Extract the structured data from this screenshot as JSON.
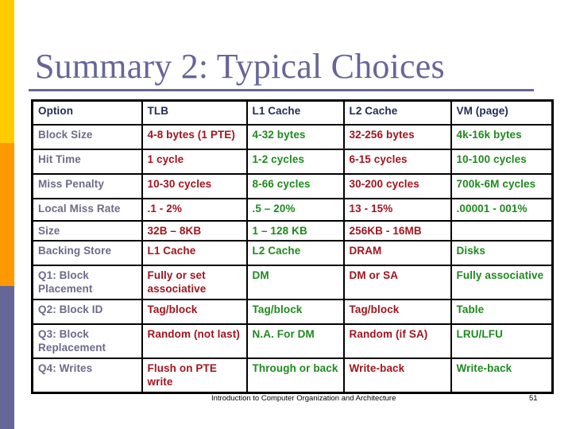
{
  "slide": {
    "title": "Summary 2: Typical Choices",
    "footer": "Introduction to Computer Organization and Architecture",
    "page_number": "51"
  },
  "colors": {
    "bar_top": "#ffcc00",
    "bar_middle": "#ff9900",
    "bar_bottom": "#666699",
    "title": "#666699",
    "header_text": "#1f2d55",
    "row_label_text": "#6b6b8a",
    "red_columns_text": "#a1141e",
    "green_columns_text": "#1e8a1e"
  },
  "table": {
    "headers": [
      "Option",
      "TLB",
      "L1 Cache",
      "L2 Cache",
      "VM (page)"
    ],
    "rows": [
      [
        "Block Size",
        "4-8 bytes (1 PTE)",
        "4-32 bytes",
        "32-256 bytes",
        "4k-16k bytes"
      ],
      [
        "Hit Time",
        "1 cycle",
        "1-2 cycles",
        "6-15 cycles",
        "10-100 cycles"
      ],
      [
        "Miss Penalty",
        "10-30 cycles",
        "8-66 cycles",
        "30-200 cycles",
        "700k-6M cycles"
      ],
      [
        "Local Miss Rate",
        ".1 - 2%",
        ".5 – 20%",
        "13 - 15%",
        ".00001 - 001%"
      ],
      [
        "Size",
        "32B – 8KB",
        "1 – 128 KB",
        "256KB - 16MB",
        ""
      ],
      [
        "Backing Store",
        "L1 Cache",
        "L2 Cache",
        "DRAM",
        "Disks"
      ],
      [
        "Q1: Block Placement",
        "Fully or set associative",
        "DM",
        "DM or SA",
        "Fully associative"
      ],
      [
        "Q2: Block ID",
        "Tag/block",
        "Tag/block",
        "Tag/block",
        "Table"
      ],
      [
        "Q3: Block Replacement",
        "Random (not last)",
        "N.A.  For DM",
        "Random (if SA)",
        "LRU/LFU"
      ],
      [
        "Q4: Writes",
        "Flush on PTE write",
        "Through or back",
        "Write-back",
        "Write-back"
      ]
    ]
  }
}
